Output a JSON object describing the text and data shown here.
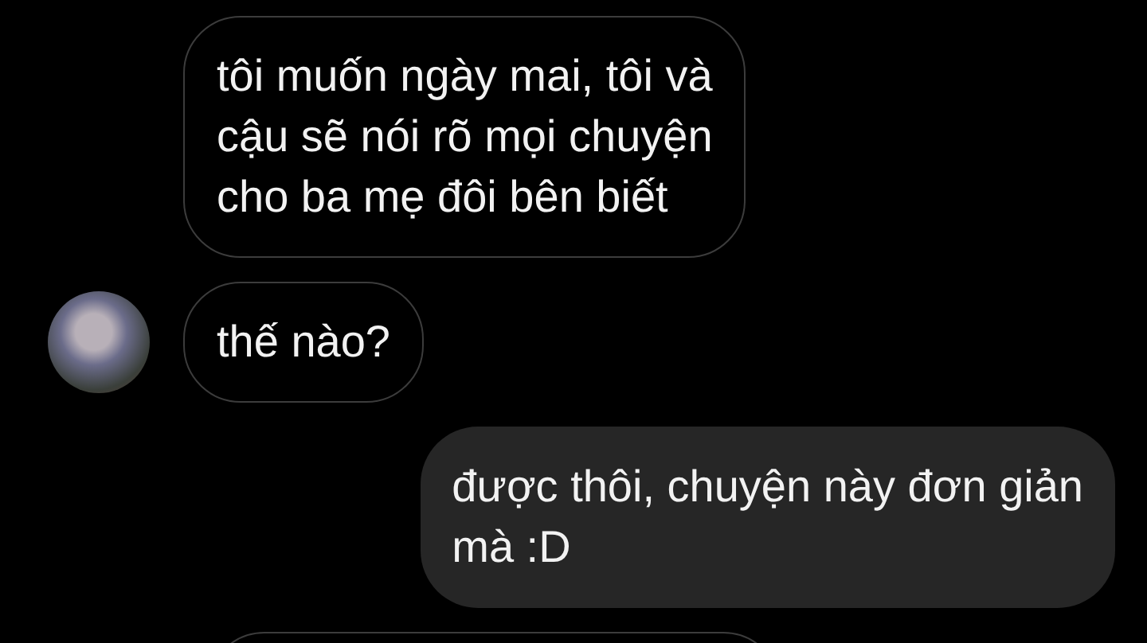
{
  "messages": [
    {
      "kind": "received",
      "avatar": false,
      "text": "tôi muốn ngày mai, tôi và\ncậu sẽ nói rõ mọi chuyện\ncho ba mẹ đôi bên biết"
    },
    {
      "kind": "received",
      "avatar": true,
      "text": "thế nào?"
    },
    {
      "kind": "sent",
      "text": "được thôi, chuyện này đơn giản\nmà :D"
    },
    {
      "kind": "partial"
    }
  ]
}
